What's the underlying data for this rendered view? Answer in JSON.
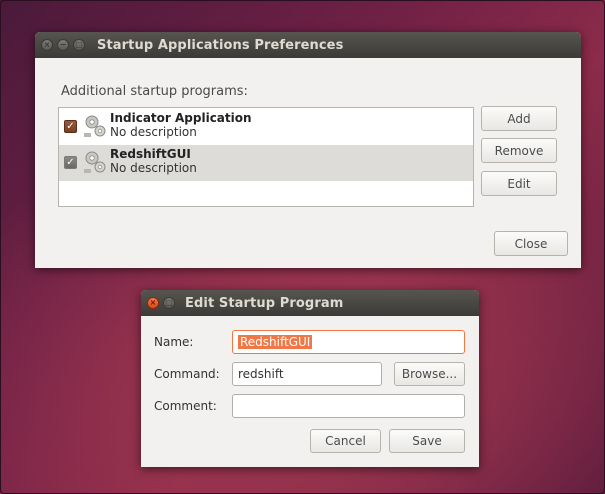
{
  "prefs_window": {
    "title": "Startup Applications Preferences",
    "section_label": "Additional startup programs:",
    "programs": [
      {
        "name": "Indicator Application",
        "description": "No description",
        "enabled": true,
        "selected": false
      },
      {
        "name": "RedshiftGUI",
        "description": "No description",
        "enabled": true,
        "selected": true
      }
    ],
    "buttons": {
      "add": "Add",
      "remove": "Remove",
      "edit": "Edit",
      "close": "Close"
    }
  },
  "edit_dialog": {
    "title": "Edit Startup Program",
    "name_label": "Name:",
    "name_value": "RedshiftGUI",
    "command_label": "Command:",
    "command_value": "redshift",
    "browse_label": "Browse...",
    "comment_label": "Comment:",
    "comment_value": "",
    "cancel_label": "Cancel",
    "save_label": "Save"
  },
  "colors": {
    "accent": "#f07746",
    "titlebar": "#3c3b37",
    "window_bg": "#f2f1f0"
  },
  "icons": [
    "close-icon",
    "minimize-icon",
    "maximize-icon",
    "gear-icon",
    "checkbox-checked-icon"
  ]
}
